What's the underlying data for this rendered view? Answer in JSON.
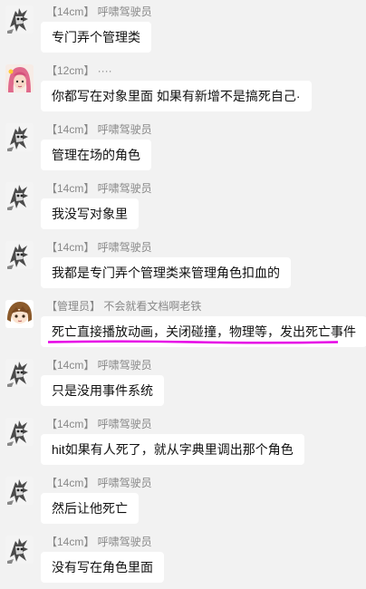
{
  "highlight_color": "#e600e6",
  "messages": [
    {
      "sender": "【14cm】 呼啸驾驶员",
      "text": "专门弄个管理类",
      "avatar": "sketch-character-avatar"
    },
    {
      "sender": "【12cm】 ····",
      "text": "你都写在对象里面 如果有新增不是搞死自己·",
      "avatar": "pink-hair-avatar"
    },
    {
      "sender": "【14cm】 呼啸驾驶员",
      "text": "管理在场的角色",
      "avatar": "sketch-character-avatar"
    },
    {
      "sender": "【14cm】 呼啸驾驶员",
      "text": "我没写对象里",
      "avatar": "sketch-character-avatar"
    },
    {
      "sender": "【14cm】 呼啸驾驶员",
      "text": "我都是专门弄个管理类来管理角色扣血的",
      "avatar": "sketch-character-avatar"
    },
    {
      "sender": "【管理员】 不会就看文档啊老铁",
      "text": "死亡直接播放动画，关闭碰撞，物理等，发出死亡事件",
      "avatar": "brown-hair-anime-avatar"
    },
    {
      "sender": "【14cm】 呼啸驾驶员",
      "text": "只是没用事件系统",
      "avatar": "sketch-character-avatar"
    },
    {
      "sender": "【14cm】 呼啸驾驶员",
      "text": "hit如果有人死了，就从字典里调出那个角色",
      "avatar": "sketch-character-avatar"
    },
    {
      "sender": "【14cm】 呼啸驾驶员",
      "text": "然后让他死亡",
      "avatar": "sketch-character-avatar"
    },
    {
      "sender": "【14cm】 呼啸驾驶员",
      "text": "没有写在角色里面",
      "avatar": "sketch-character-avatar"
    }
  ]
}
